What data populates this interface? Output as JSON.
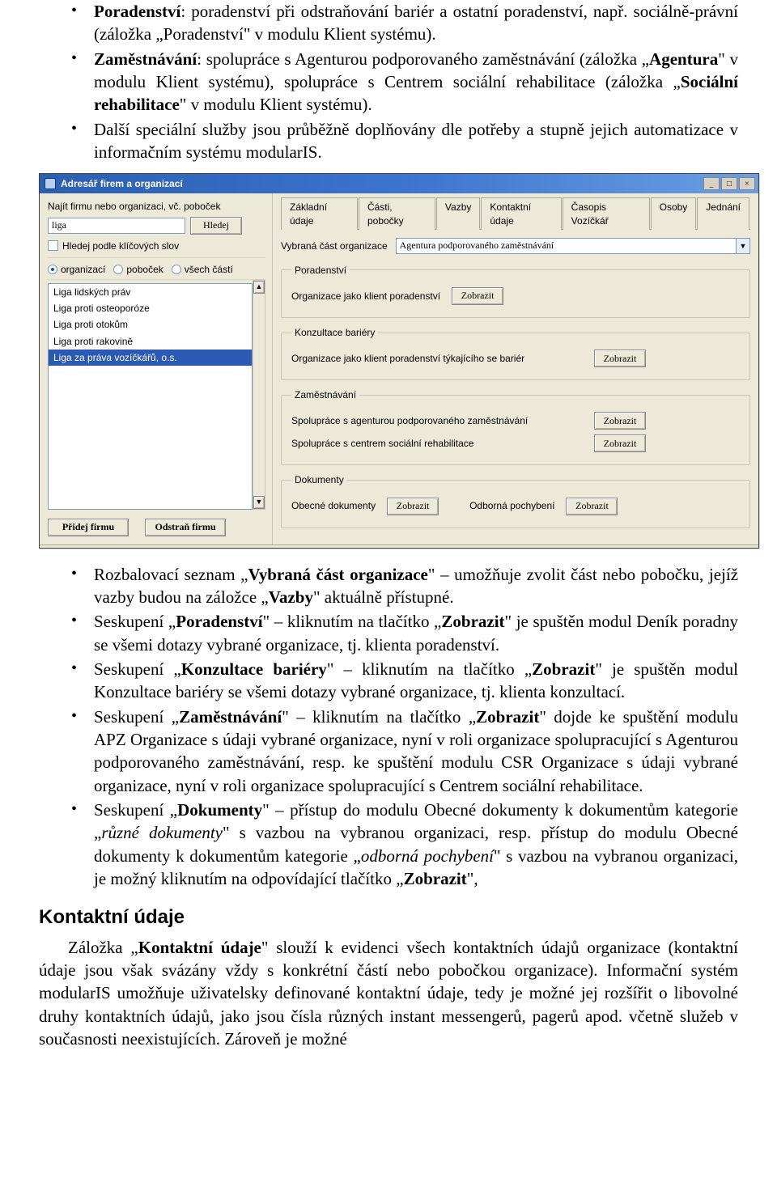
{
  "top_bullets": [
    {
      "prefix": "Poradenství",
      "rest": ": poradenství při odstraňování bariér a ostatní poradenství, např. sociálně-právní (záložka „Poradenství\" v modulu Klient systému)."
    },
    {
      "prefix": "Zaměstnávání",
      "rest": ": spolupráce s Agenturou podporovaného zaměstnávání (záložka „<b>Agentura</b>\" v modulu Klient systému), spolupráce s Centrem sociální rehabilitace (záložka „<b>Sociální rehabilitace</b>\" v modulu Klient systému)."
    },
    {
      "plain": "Další speciální služby jsou průběžně doplňovány dle potřeby a stupně jejich automatizace v informačním systému modularIS."
    }
  ],
  "window": {
    "title": "Adresář firem a organizací",
    "min": "_",
    "max": "□",
    "close": "×",
    "search_label": "Najít firmu nebo organizaci, vč. poboček",
    "search_value": "liga",
    "hledej": "Hledej",
    "keywords_label": "Hledej podle klíčových slov",
    "radios": {
      "org": "organizací",
      "pob": "poboček",
      "vse": "všech částí"
    },
    "results": [
      "Liga lidských práv",
      "Liga proti osteoporóze",
      "Liga proti otokům",
      "Liga proti rakovině",
      "Liga za práva vozíčkářů, o.s."
    ],
    "add_btn": "Přidej firmu",
    "del_btn": "Odstraň firmu",
    "tabs": [
      "Základní údaje",
      "Části, pobočky",
      "Vazby",
      "Kontaktní údaje",
      "Časopis Vozíčkář",
      "Osoby",
      "Jednání"
    ],
    "active_tab": 2,
    "part_label": "Vybraná část organizace",
    "part_value": "Agentura podporovaného zaměstnávání",
    "groups": {
      "poradenstvi": {
        "legend": "Poradenství",
        "rows": [
          {
            "text": "Organizace jako klient poradenství",
            "btn": "Zobrazit"
          }
        ]
      },
      "konzultace": {
        "legend": "Konzultace bariéry",
        "rows": [
          {
            "text": "Organizace jako klient poradenství týkajícího se bariér",
            "btn": "Zobrazit"
          }
        ]
      },
      "zamestnavani": {
        "legend": "Zaměstnávání",
        "rows": [
          {
            "text": "Spolupráce s agenturou podporovaného zaměstnávání",
            "btn": "Zobrazit"
          },
          {
            "text": "Spolupráce s centrem sociální rehabilitace",
            "btn": "Zobrazit"
          }
        ]
      },
      "dokumenty": {
        "legend": "Dokumenty",
        "rows": [
          {
            "text": "Obecné dokumenty",
            "btn": "Zobrazit",
            "text2": "Odborná pochybení",
            "btn2": "Zobrazit"
          }
        ]
      }
    }
  },
  "mid_bullets": [
    "Rozbalovací seznam „<b>Vybraná část organizace</b>\" – umožňuje zvolit část nebo pobočku, jejíž vazby budou na záložce „<b>Vazby</b>\" aktuálně přístupné.",
    "Seskupení „<b>Poradenství</b>\" – kliknutím na tlačítko „<b>Zobrazit</b>\" je spuštěn modul Deník poradny se všemi dotazy vybrané organizace, tj. klienta poradenství.",
    "Seskupení „<b>Konzultace bariéry</b>\" – kliknutím na tlačítko „<b>Zobrazit</b>\" je spuštěn modul Konzultace bariéry se všemi dotazy vybrané organizace, tj. klienta konzultací.",
    "Seskupení „<b>Zaměstnávání</b>\" – kliknutím na tlačítko „<b>Zobrazit</b>\" dojde ke spuštění modulu APZ Organizace s údaji vybrané organizace, nyní v roli organizace spolupracující s Agenturou podporovaného zaměstnávání, resp. ke spuštění modulu CSR Organizace s údaji vybrané organizace, nyní v roli organizace spolupracující s Centrem sociální rehabilitace.",
    "Seskupení „<b>Dokumenty</b>\" – přístup do modulu Obecné dokumenty k dokumentům kategorie „<i>různé dokumenty</i>\" s vazbou na vybranou organizaci, resp. přístup do modulu Obecné dokumenty k dokumentům kategorie „<i>odborná pochybení</i>\" s vazbou na vybranou organizaci, je možný kliknutím na odpovídající tlačítko „<b>Zobrazit</b>\","
  ],
  "section_heading": "Kontaktní údaje",
  "closing_para": "Záložka „<b>Kontaktní údaje</b>\" slouží k evidenci všech kontaktních údajů organizace (kontaktní údaje jsou však svázány vždy s konkrétní částí nebo pobočkou organizace). Informační systém modularIS umožňuje uživatelsky definované kontaktní údaje, tedy je možné jej rozšířit o libovolné druhy kontaktních údajů, jako jsou čísla různých instant messengerů, pagerů apod. včetně služeb v současnosti neexistujících. Zároveň je možné"
}
